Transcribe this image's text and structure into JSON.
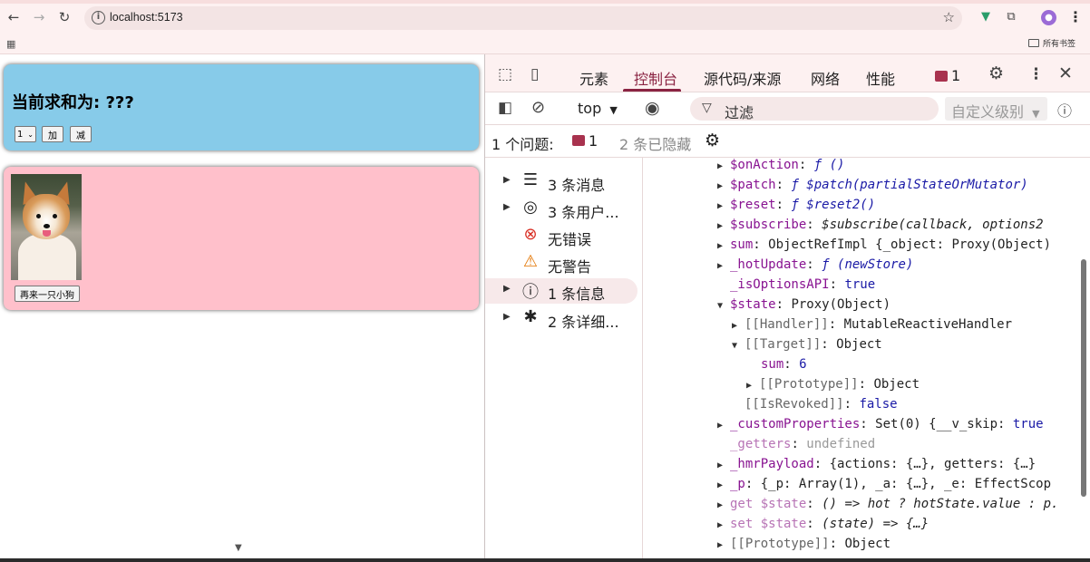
{
  "browser": {
    "url": "localhost:5173",
    "bookmarks_label": "所有书签",
    "icons": [
      "back-icon",
      "forward-icon",
      "reload-icon",
      "info-icon",
      "star-icon",
      "vue-devtools-icon",
      "extensions-icon",
      "profile-icon",
      "menu-icon",
      "apps-icon",
      "folder-icon"
    ]
  },
  "app": {
    "sum_title": "当前求和为: ???",
    "select_value": "1",
    "add_label": "加",
    "sub_label": "减",
    "dog_button": "再来一只小狗"
  },
  "devtools": {
    "tabs": [
      {
        "label": "元素"
      },
      {
        "label": "控制台"
      },
      {
        "label": "源代码/来源"
      },
      {
        "label": "网络"
      },
      {
        "label": "性能"
      }
    ],
    "message_count": "1",
    "context": "top",
    "filter_placeholder": "过滤",
    "levels_label": "自定义级别",
    "issues": {
      "label": "1 个问题:",
      "count": "1",
      "hidden": "2 条已隐藏"
    },
    "sidebar": [
      {
        "label": "3 条消息",
        "icon": "list-icon"
      },
      {
        "label": "3 条用户...",
        "icon": "user-icon"
      },
      {
        "label": "无错误",
        "icon": "error-icon"
      },
      {
        "label": "无警告",
        "icon": "warning-icon"
      },
      {
        "label": "1 条信息",
        "icon": "info-icon"
      },
      {
        "label": "2 条详细...",
        "icon": "bug-icon"
      }
    ],
    "console_lines": {
      "l1_key": "$onAction",
      "l1_val": "ƒ ()",
      "l2_key": "$patch",
      "l2_val": "ƒ $patch(partialStateOrMutator)",
      "l3_key": "$reset",
      "l3_val": "ƒ $reset2()",
      "l4_key": "$subscribe",
      "l4_val": "$subscribe(callback, options2",
      "l5_key": "sum",
      "l5_val": "ObjectRefImpl  {_object: Proxy(Object)",
      "l6_key": "_hotUpdate",
      "l6_val": "ƒ (newStore)",
      "l7_key": "_isOptionsAPI",
      "l7_val": "true",
      "l8_key": "$state",
      "l8_val": "Proxy(Object)",
      "l9_key": "[[Handler]]",
      "l9_val": "MutableReactiveHandler",
      "l10_key": "[[Target]]",
      "l10_val": "Object",
      "l11_key": "sum",
      "l11_val": "6",
      "l12_key": "[[Prototype]]",
      "l12_val": "Object",
      "l13_key": "[[IsRevoked]]",
      "l13_val": "false",
      "l14_key": "_customProperties",
      "l14_val": "Set(0)  {__v_skip: ",
      "l14_val2": "true",
      "l15_key": "_getters",
      "l15_val": "undefined",
      "l16_key": "_hmrPayload",
      "l16_val": "{actions: {…}, getters: {…}",
      "l17_key": "_p",
      "l17_val": "{_p: Array(1), _a: {…}, _e: EffectScop",
      "l18_key": "get $state",
      "l18_val": "() => hot ? hotState.value : p.",
      "l19_key": "set $state",
      "l19_val": "(state) => {…}",
      "l20_key": "[[Prototype]]",
      "l20_val": "Object"
    }
  }
}
